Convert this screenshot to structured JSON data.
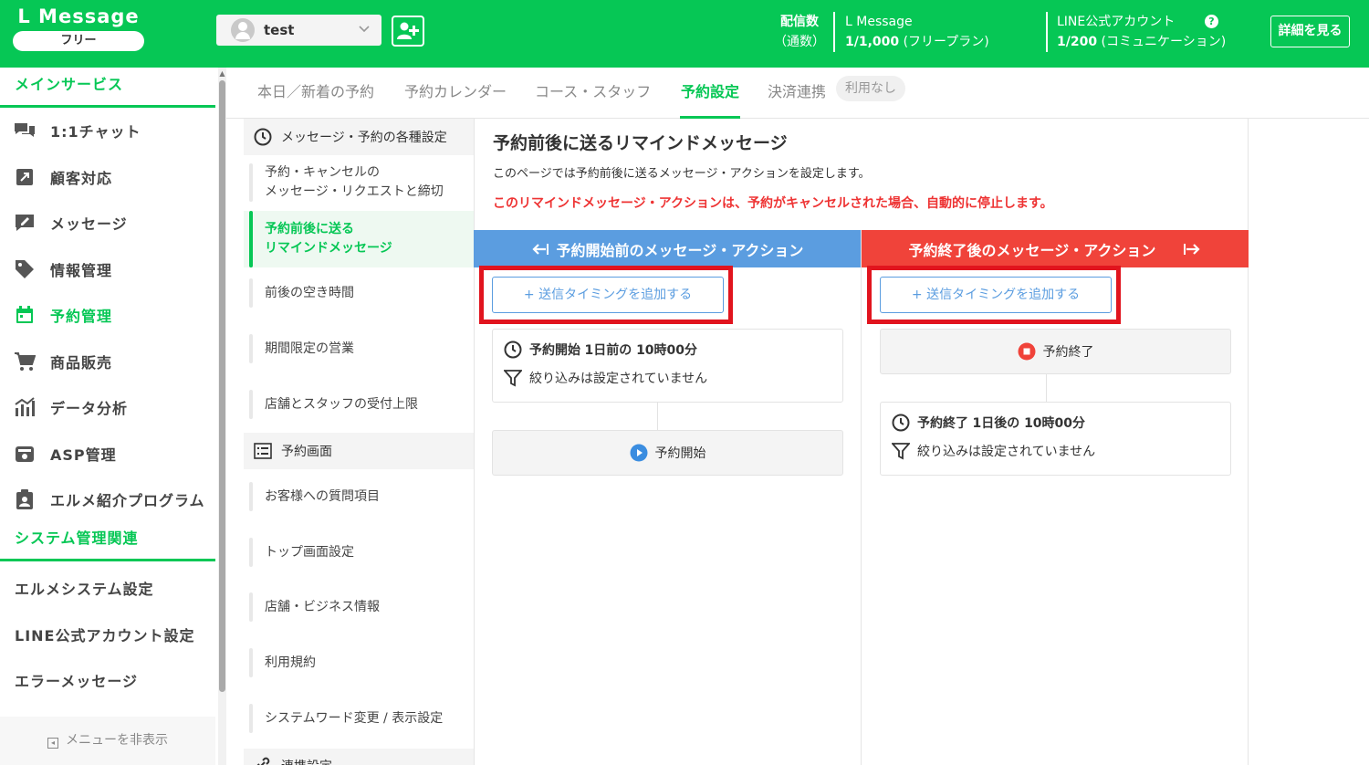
{
  "header": {
    "logo": "L Message",
    "plan_badge": "フリー",
    "account_name": "test",
    "delivery_label": "配信数",
    "delivery_sub": "（通数）",
    "lmessage_label": "L Message",
    "lmessage_value": "1/1,000",
    "lmessage_plan": "(フリープラン)",
    "line_label": "LINE公式アカウント",
    "line_value": "1/200",
    "line_plan": "(コミュニケーション)",
    "help_icon": "?",
    "detail_button": "詳細を見る"
  },
  "sidebar": {
    "main_section": "メインサービス",
    "items": [
      {
        "label": "1:1チャット",
        "icon": "chat-icon"
      },
      {
        "label": "顧客対応",
        "icon": "customer-icon"
      },
      {
        "label": "メッセージ",
        "icon": "message-icon"
      },
      {
        "label": "情報管理",
        "icon": "tag-icon"
      },
      {
        "label": "予約管理",
        "icon": "calendar-icon"
      },
      {
        "label": "商品販売",
        "icon": "cart-icon"
      },
      {
        "label": "データ分析",
        "icon": "chart-icon"
      },
      {
        "label": "ASP管理",
        "icon": "asp-icon"
      },
      {
        "label": "エルメ紹介プログラム",
        "icon": "clipboard-icon"
      }
    ],
    "system_section": "システム管理関連",
    "system_items": [
      "エルメシステム設定",
      "LINE公式アカウント設定",
      "エラーメッセージ"
    ],
    "hide_menu": "メニューを非表示"
  },
  "tabs": [
    {
      "label": "本日／新着の予約"
    },
    {
      "label": "予約カレンダー"
    },
    {
      "label": "コース・スタッフ"
    },
    {
      "label": "予約設定"
    },
    {
      "label": "決済連携"
    }
  ],
  "tab_badge": "利用なし",
  "subnav": {
    "group1": "メッセージ・予約の各種設定",
    "item_cancel_1": "予約・キャンセルの",
    "item_cancel_2": "メッセージ・リクエストと締切",
    "item_remind_1": "予約前後に送る",
    "item_remind_2": "リマインドメッセージ",
    "item_gap": "前後の空き時間",
    "item_limited": "期間限定の営業",
    "item_capacity": "店舗とスタッフの受付上限",
    "group2": "予約画面",
    "item_questions": "お客様への質問項目",
    "item_top": "トップ画面設定",
    "item_store": "店舗・ビジネス情報",
    "item_terms": "利用規約",
    "item_words": "システムワード変更 / 表示設定",
    "group3": "連携設定"
  },
  "main": {
    "title": "予約前後に送るリマインドメッセージ",
    "description": "このページでは予約前後に送るメッセージ・アクションを設定します。",
    "warning": "このリマインドメッセージ・アクションは、予約がキャンセルされた場合、自動的に停止します。",
    "before_header": "予約開始前のメッセージ・アクション",
    "after_header": "予約終了後のメッセージ・アクション",
    "add_timing": "+ 送信タイミングを追加する",
    "before_timing_prefix": "予約開始",
    "before_timing": "1日前の 10時00分",
    "filter_none": "絞り込みは設定されていません",
    "start_label": "予約開始",
    "end_label": "予約終了",
    "after_timing_prefix": "予約終了",
    "after_timing": "1日後の 10時00分"
  },
  "colors": {
    "brand": "#06c755",
    "before": "#5b9de0",
    "after": "#f0433a",
    "highlight": "#e1141e"
  }
}
